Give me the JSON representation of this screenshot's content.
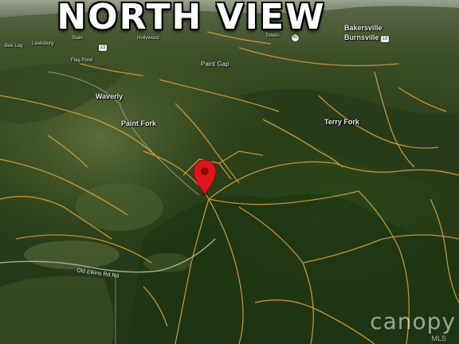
{
  "title": "NORTH VIEW",
  "places": {
    "bakersville": "Bakersville",
    "burnsville": "Burnsville",
    "toledo": "Toledo",
    "paint_gap": "Paint Gap",
    "waverly": "Waverly",
    "paint_fork": "Paint Fork",
    "terry_fork": "Terry Fork",
    "lewisburg": "Lewisburg",
    "stain": "Stain",
    "flag_pond": "Flag Pond",
    "hollywood": "Hollywood",
    "bee_log": "Bee Log"
  },
  "road_label": "Old Elkins Rd Rd",
  "shields": {
    "us": "23",
    "nc": "80",
    "other": "19"
  },
  "marker": {
    "color": "#e0151b",
    "icon": "location-pin-icon"
  },
  "watermark": {
    "brand": "canopy",
    "sub": "MLS"
  },
  "colors": {
    "parcel_lines": "#e0a23a",
    "forest": "#243816"
  }
}
